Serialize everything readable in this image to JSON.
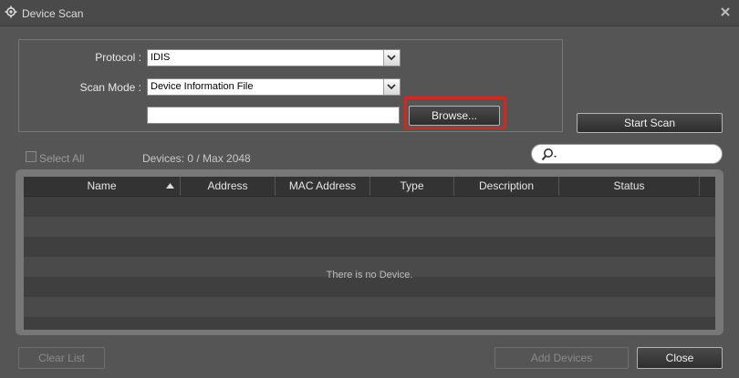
{
  "window": {
    "title": "Device Scan"
  },
  "form": {
    "protocol_label": "Protocol :",
    "protocol_value": "IDIS",
    "scan_mode_label": "Scan Mode :",
    "scan_mode_value": "Device Information File",
    "file_path_value": "",
    "browse_label": "Browse...",
    "start_scan_label": "Start Scan"
  },
  "list_toolbar": {
    "select_all_label": "Select All",
    "select_all_checked": false,
    "devices_count": "Devices: 0 / Max 2048",
    "search_value": ""
  },
  "table": {
    "columns": [
      "Name",
      "Address",
      "MAC Address",
      "Type",
      "Description",
      "Status"
    ],
    "sorted_column": "Name",
    "sort_direction": "ascending",
    "rows": [],
    "empty_message": "There is no Device."
  },
  "footer": {
    "clear_list_label": "Clear List",
    "add_devices_label": "Add Devices",
    "close_label": "Close"
  },
  "colors": {
    "background": "#555555",
    "highlight_border": "#d9261c"
  },
  "icons": {
    "title": "gear-icon",
    "close": "close-icon",
    "dropdown": "chevron-down-icon",
    "search": "search-icon",
    "sort": "sort-ascending-icon"
  }
}
